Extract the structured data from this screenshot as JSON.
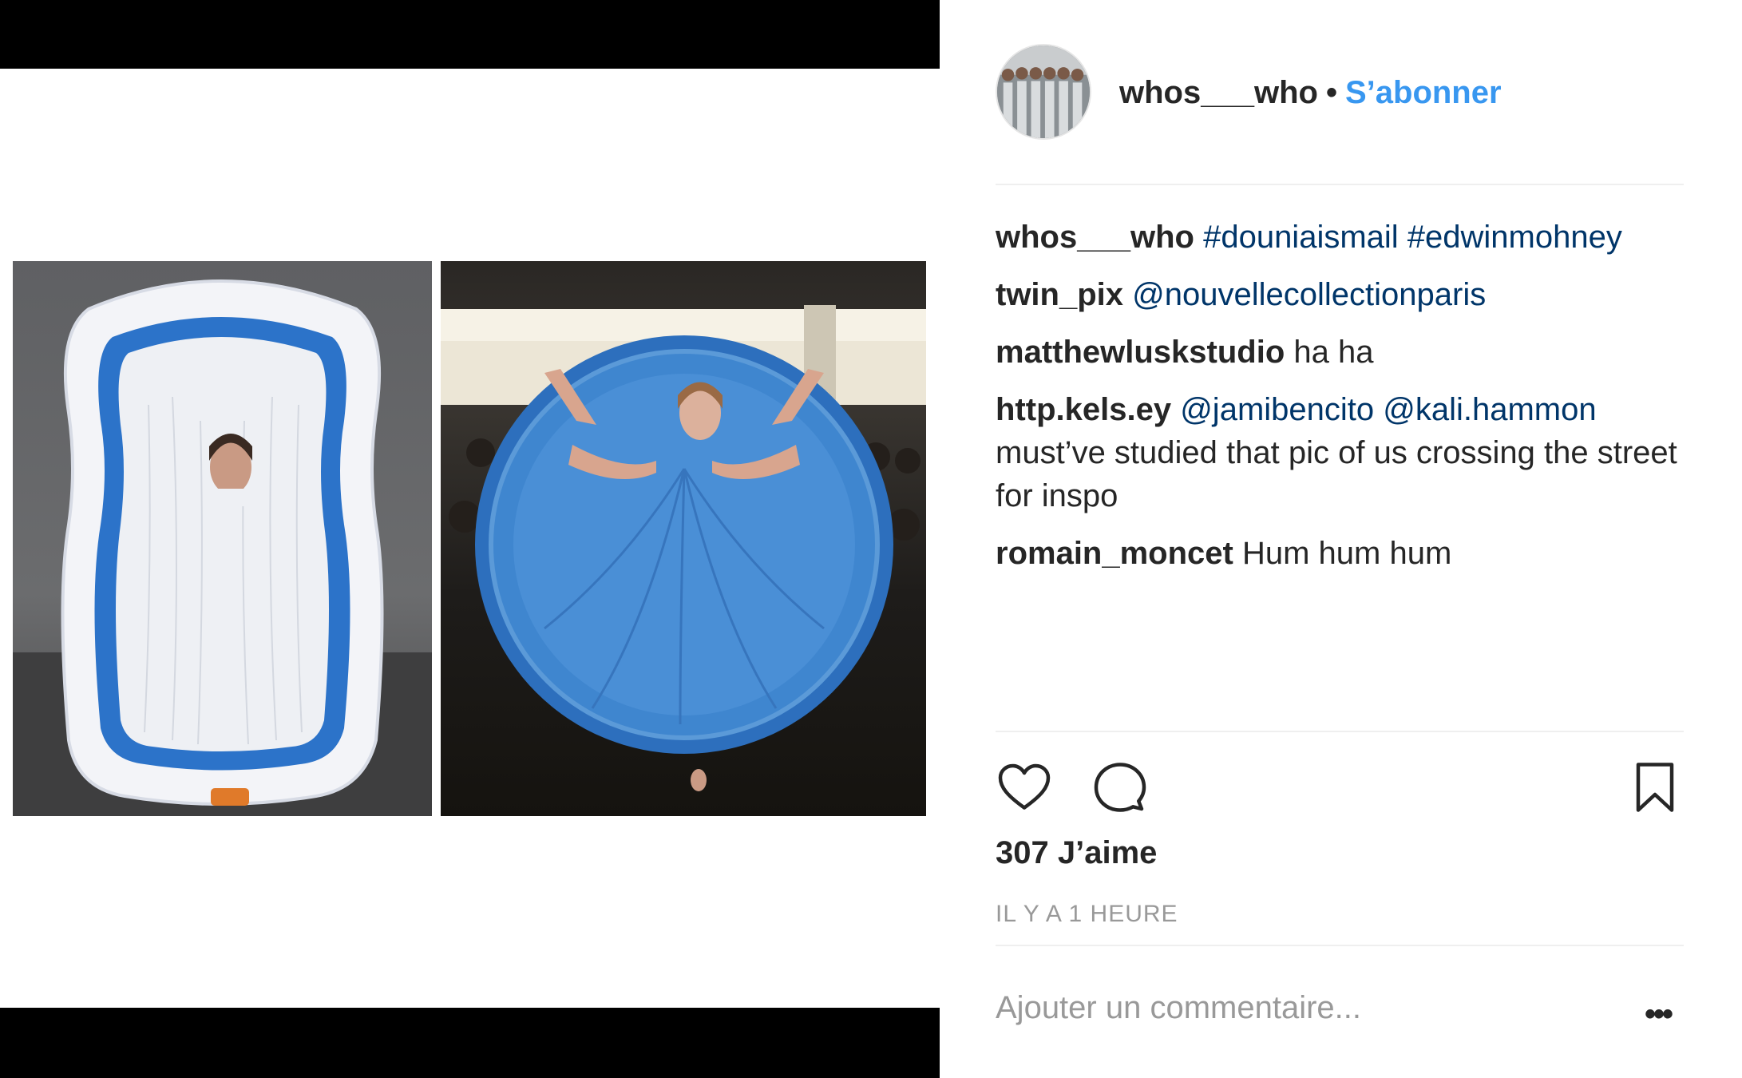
{
  "post": {
    "username": "whos___who",
    "separator": "•",
    "follow_label": "S’abonner"
  },
  "comments": [
    {
      "user": "whos___who",
      "tags": "#douniaismail #edwinmohney",
      "text": ""
    },
    {
      "user": "twin_pix",
      "tags": "@nouvellecollectionparis",
      "text": ""
    },
    {
      "user": "matthewluskstudio",
      "tags": "",
      "text": "ha ha"
    },
    {
      "user": "http.kels.ey",
      "tags": "@jamibencito @kali.hammon",
      "text": "must’ve studied that pic of us crossing the street for inspo"
    },
    {
      "user": "romain_moncet",
      "tags": "",
      "text": "Hum hum hum"
    }
  ],
  "actions": {
    "likes": "307 J’aime",
    "time": "IL Y A 1 HEURE",
    "comment_placeholder": "Ajouter un commentaire...",
    "more": "•••"
  },
  "colors": {
    "link": "#3897f0",
    "tag": "#003569",
    "muted": "#999999",
    "text": "#262626"
  },
  "icons": [
    "heart-icon",
    "comment-icon",
    "bookmark-icon",
    "more-icon"
  ]
}
